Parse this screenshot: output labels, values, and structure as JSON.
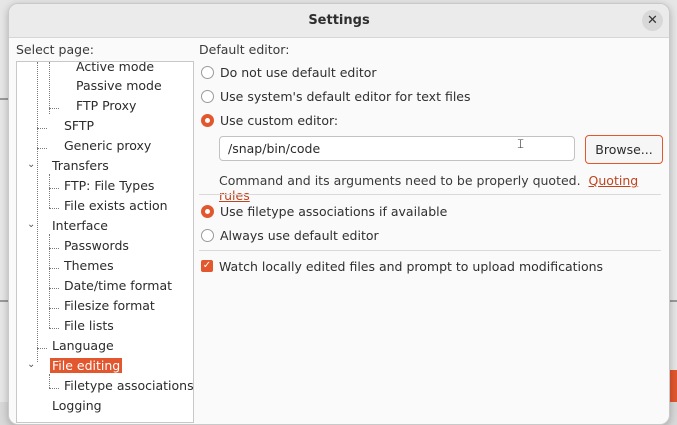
{
  "dialog": {
    "title": "Settings",
    "close_glyph": "✕"
  },
  "sidebar": {
    "label": "Select page:",
    "items": [
      {
        "label": "Active mode",
        "level": 3
      },
      {
        "label": "Passive mode",
        "level": 3
      },
      {
        "label": "FTP Proxy",
        "level": 3
      },
      {
        "label": "SFTP",
        "level": 2
      },
      {
        "label": "Generic proxy",
        "level": 2
      },
      {
        "label": "Transfers",
        "level": 1
      },
      {
        "label": "FTP: File Types",
        "level": 2
      },
      {
        "label": "File exists action",
        "level": 2
      },
      {
        "label": "Interface",
        "level": 1
      },
      {
        "label": "Passwords",
        "level": 2
      },
      {
        "label": "Themes",
        "level": 2
      },
      {
        "label": "Date/time format",
        "level": 2
      },
      {
        "label": "Filesize format",
        "level": 2
      },
      {
        "label": "File lists",
        "level": 2
      },
      {
        "label": "Language",
        "level": 1
      },
      {
        "label": "File editing",
        "level": 1,
        "selected": true
      },
      {
        "label": "Filetype associations",
        "level": 2
      },
      {
        "label": "Logging",
        "level": 1
      }
    ]
  },
  "editor": {
    "section_label": "Default editor:",
    "options": [
      {
        "label": "Do not use default editor",
        "checked": false
      },
      {
        "label": "Use system's default editor for text files",
        "checked": false
      },
      {
        "label": "Use custom editor:",
        "checked": true
      }
    ],
    "custom_path": "/snap/bin/code",
    "browse_label": "Browse...",
    "hint": "Command and its arguments need to be properly quoted.",
    "quoting_link": "Quoting rules"
  },
  "association": {
    "options": [
      {
        "label": "Use filetype associations if available",
        "checked": true
      },
      {
        "label": "Always use default editor",
        "checked": false
      }
    ]
  },
  "watch": {
    "label": "Watch locally edited files and prompt to upload modifications",
    "checked": true
  },
  "colors": {
    "accent": "#e2572e",
    "link": "#c0441f"
  }
}
